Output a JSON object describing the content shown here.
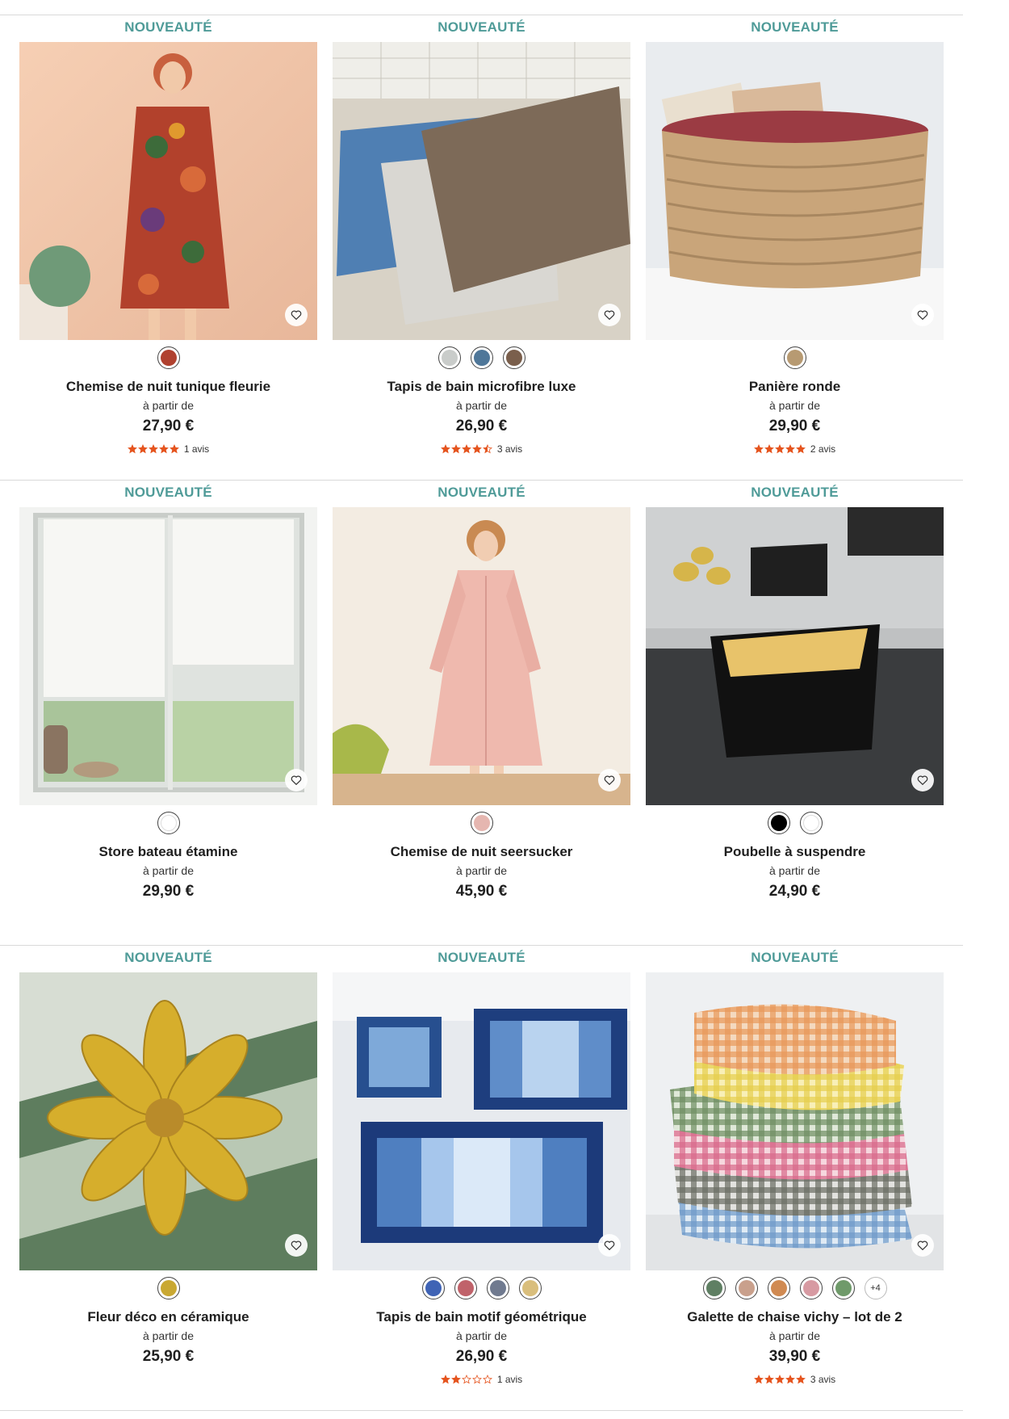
{
  "products": [
    {
      "badge": "NOUVEAUTÉ",
      "title": "Chemise de nuit tunique fleurie",
      "from": "à partir de",
      "price": "27,90 €",
      "rating": 5,
      "reviews": "1 avis",
      "swatches": [
        "#b0412f"
      ],
      "more": "",
      "image": "floral-dress-photo"
    },
    {
      "badge": "NOUVEAUTÉ",
      "title": "Tapis de bain microfibre luxe",
      "from": "à partir de",
      "price": "26,90 €",
      "rating": 4.5,
      "reviews": "3 avis",
      "swatches": [
        "#c9ccca",
        "#4f7799",
        "#7a5f4c"
      ],
      "more": "",
      "image": "bath-mats-photo"
    },
    {
      "badge": "NOUVEAUTÉ",
      "title": "Panière ronde",
      "from": "à partir de",
      "price": "29,90 €",
      "rating": 5,
      "reviews": "2 avis",
      "swatches": [
        "#b79a72"
      ],
      "more": "",
      "image": "round-basket-photo"
    },
    {
      "badge": "NOUVEAUTÉ",
      "title": "Store bateau étamine",
      "from": "à partir de",
      "price": "29,90 €",
      "rating": 0,
      "reviews": "",
      "swatches": [
        "#ffffff"
      ],
      "more": "",
      "image": "roman-blind-photo"
    },
    {
      "badge": "NOUVEAUTÉ",
      "title": "Chemise de nuit seersucker",
      "from": "à partir de",
      "price": "45,90 €",
      "rating": 0,
      "reviews": "",
      "swatches": [
        "#e5b6b0"
      ],
      "more": "",
      "image": "pink-nightdress-photo"
    },
    {
      "badge": "NOUVEAUTÉ",
      "title": "Poubelle à suspendre",
      "from": "à partir de",
      "price": "24,90 €",
      "rating": 0,
      "reviews": "",
      "swatches": [
        "#000000",
        "#ffffff"
      ],
      "more": "",
      "image": "hanging-bin-photo"
    },
    {
      "badge": "NOUVEAUTÉ",
      "title": "Fleur déco en céramique",
      "from": "à partir de",
      "price": "25,90 €",
      "rating": 0,
      "reviews": "",
      "swatches": [
        "#c9a832"
      ],
      "more": "",
      "image": "ceramic-flower-photo"
    },
    {
      "badge": "NOUVEAUTÉ",
      "title": "Tapis de bain motif géométrique",
      "from": "à partir de",
      "price": "26,90 €",
      "rating": 2,
      "reviews": "1 avis",
      "swatches": [
        "#3f63b5",
        "#c0626a",
        "#707a8f",
        "#d9be7c"
      ],
      "more": "",
      "image": "geometric-bath-mat-photo"
    },
    {
      "badge": "NOUVEAUTÉ",
      "title": "Galette de chaise vichy – lot de 2",
      "from": "à partir de",
      "price": "39,90 €",
      "rating": 5,
      "reviews": "3 avis",
      "swatches": [
        "#5f7f63",
        "#c9a08c",
        "#d08a52",
        "#d79aa2",
        "#6f9a6a"
      ],
      "more": "+4",
      "image": "gingham-cushions-photo"
    }
  ],
  "colors": {
    "badge": "#4f9b98",
    "star": "#e5541e"
  }
}
